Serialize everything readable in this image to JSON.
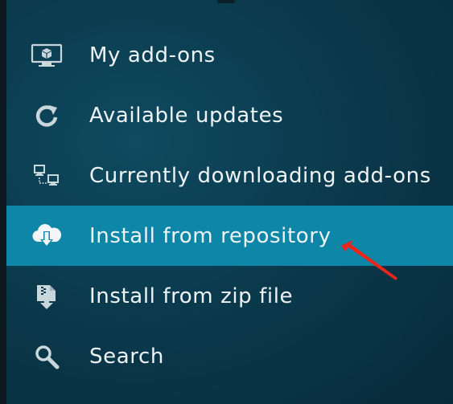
{
  "menu": {
    "items": [
      {
        "label": "My add-ons",
        "icon": "monitor-box-icon",
        "selected": false
      },
      {
        "label": "Available updates",
        "icon": "refresh-icon",
        "selected": false
      },
      {
        "label": "Currently downloading add-ons",
        "icon": "network-computers-icon",
        "selected": false
      },
      {
        "label": "Install from repository",
        "icon": "cloud-download-icon",
        "selected": true
      },
      {
        "label": "Install from zip file",
        "icon": "zip-install-icon",
        "selected": false
      },
      {
        "label": "Search",
        "icon": "search-icon",
        "selected": false
      }
    ]
  },
  "colors": {
    "selected_background": "#0e86a8",
    "annotation_arrow": "#e8261c",
    "text": "#eef3f6"
  }
}
